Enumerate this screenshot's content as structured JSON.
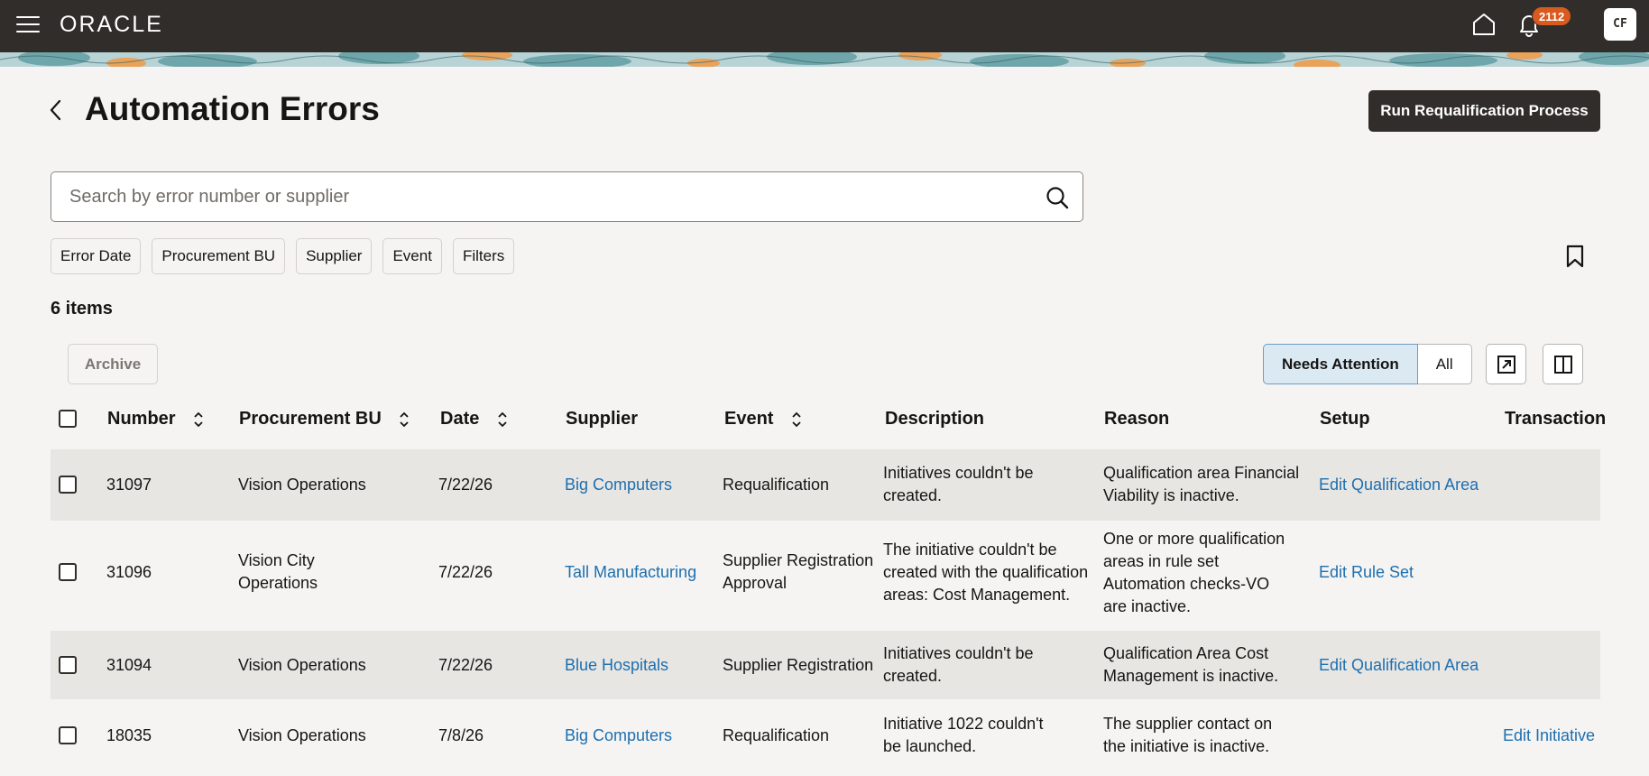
{
  "topbar": {
    "logo": "ORACLE",
    "notification_count": "2112",
    "avatar_initials": "CF"
  },
  "header": {
    "title": "Automation Errors",
    "run_button": "Run Requalification Process"
  },
  "search": {
    "placeholder": "Search by error number or supplier"
  },
  "filters": [
    "Error Date",
    "Procurement BU",
    "Supplier",
    "Event",
    "Filters"
  ],
  "items_count": "6 items",
  "toolbar": {
    "archive": "Archive",
    "segments": [
      "Needs Attention",
      "All"
    ]
  },
  "table": {
    "columns": [
      "Number",
      "Procurement BU",
      "Date",
      "Supplier",
      "Event",
      "Description",
      "Reason",
      "Setup",
      "Transaction"
    ],
    "rows": [
      {
        "number": "31097",
        "bu": [
          "Vision Operations"
        ],
        "date": "7/22/26",
        "supplier": "Big Computers",
        "event": [
          "Requalification"
        ],
        "description": [
          "Initiatives couldn't be",
          "created."
        ],
        "reason": [
          "Qualification area Financial",
          "Viability is inactive."
        ],
        "setup": "Edit Qualification Area",
        "transaction": ""
      },
      {
        "number": "31096",
        "bu": [
          "Vision City",
          "Operations"
        ],
        "date": "7/22/26",
        "supplier": "Tall Manufacturing",
        "event": [
          "Supplier Registration",
          "Approval"
        ],
        "description": [
          "The initiative couldn't be",
          "created with the qualification",
          "areas: Cost Management."
        ],
        "reason": [
          "One or more qualification",
          "areas in rule set",
          "Automation checks-VO",
          "are inactive."
        ],
        "setup": "Edit Rule Set",
        "transaction": ""
      },
      {
        "number": "31094",
        "bu": [
          "Vision Operations"
        ],
        "date": "7/22/26",
        "supplier": "Blue Hospitals",
        "event": [
          "Supplier Registration"
        ],
        "description": [
          "Initiatives couldn't be",
          "created."
        ],
        "reason": [
          "Qualification Area Cost",
          "Management is inactive."
        ],
        "setup": "Edit Qualification Area",
        "transaction": ""
      },
      {
        "number": "18035",
        "bu": [
          "Vision Operations"
        ],
        "date": "7/8/26",
        "supplier": "Big Computers",
        "event": [
          "Requalification"
        ],
        "description": [
          "Initiative 1022 couldn't",
          "be launched."
        ],
        "reason": [
          "The supplier contact on",
          "the initiative is inactive."
        ],
        "setup": "",
        "transaction": "Edit Initiative"
      }
    ]
  },
  "colors": {
    "topbar": "#312d2a",
    "link": "#1d6fb0",
    "badge": "#d85a1e",
    "active_segment": "#dbe9f3"
  }
}
